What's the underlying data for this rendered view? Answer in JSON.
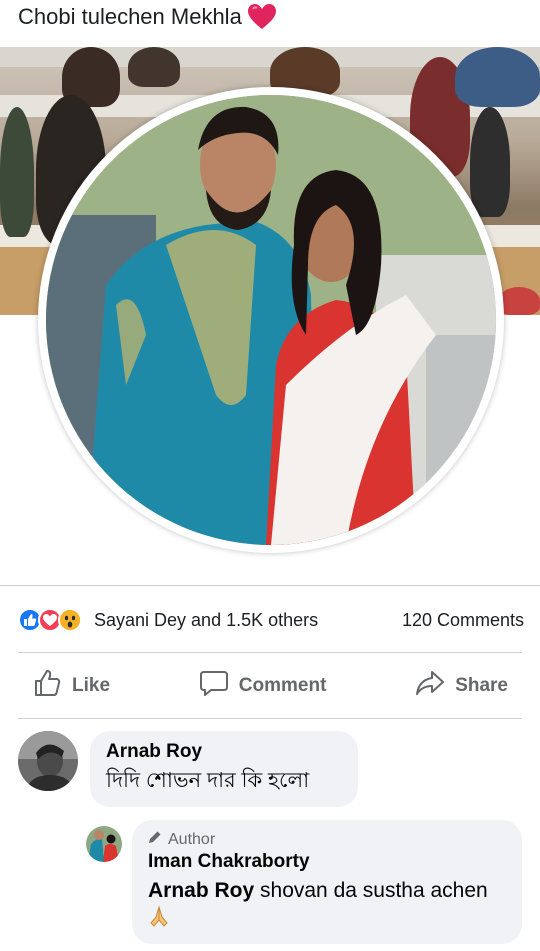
{
  "post": {
    "caption": "Chobi tulechen Mekhla",
    "caption_emoji": "red-heart-emoji"
  },
  "reactions": {
    "icons": [
      "like-icon",
      "love-icon",
      "wow-icon"
    ],
    "summary": "Sayani Dey and 1.5K others",
    "comments_count": "120 Comments"
  },
  "actions": {
    "like": "Like",
    "comment": "Comment",
    "share": "Share"
  },
  "comments": [
    {
      "author": "Arnab Roy",
      "text": "দিদি শোভন দার কি হলো"
    },
    {
      "badge": "Author",
      "author": "Iman Chakraborty",
      "mention": "Arnab Roy",
      "text": " shovan da sustha achen",
      "emoji": "folded-hands-emoji"
    }
  ],
  "colors": {
    "like_blue": "#1877f2",
    "love_red": "#f33e58",
    "wow_yellow": "#f7b125",
    "bubble_bg": "#f0f2f5",
    "secondary_text": "#65676b"
  }
}
